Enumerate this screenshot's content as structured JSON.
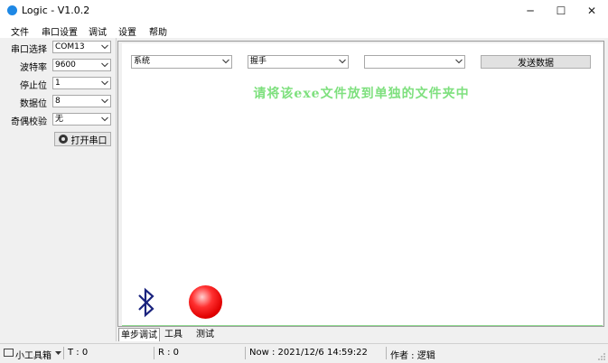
{
  "window": {
    "title": "Logic - V1.0.2",
    "minimize": "─",
    "maximize": "☐",
    "close": "✕"
  },
  "menu": [
    "文件",
    "串口设置",
    "调试",
    "设置",
    "帮助"
  ],
  "serial": {
    "port_label": "串口选择",
    "port_value": "COM13",
    "baud_label": "波特率",
    "baud_value": "9600",
    "stop_label": "停止位",
    "stop_value": "1",
    "data_label": "数据位",
    "data_value": "8",
    "parity_label": "奇偶校验",
    "parity_value": "无",
    "open_button": "打开串口"
  },
  "main": {
    "combo1": "系统",
    "combo2": "握手",
    "combo3": "",
    "send_button": "发送数据",
    "notice": "请将该exe文件放到单独的文件夹中",
    "indicator_color": "#e00000"
  },
  "tabs": [
    "单步调试",
    "工具",
    "测试"
  ],
  "status": {
    "tools": "小工具箱",
    "tx": "T : 0",
    "rx": "R : 0",
    "now": "Now : 2021/12/6 14:59:22",
    "author": "作者 : 逻辑"
  }
}
